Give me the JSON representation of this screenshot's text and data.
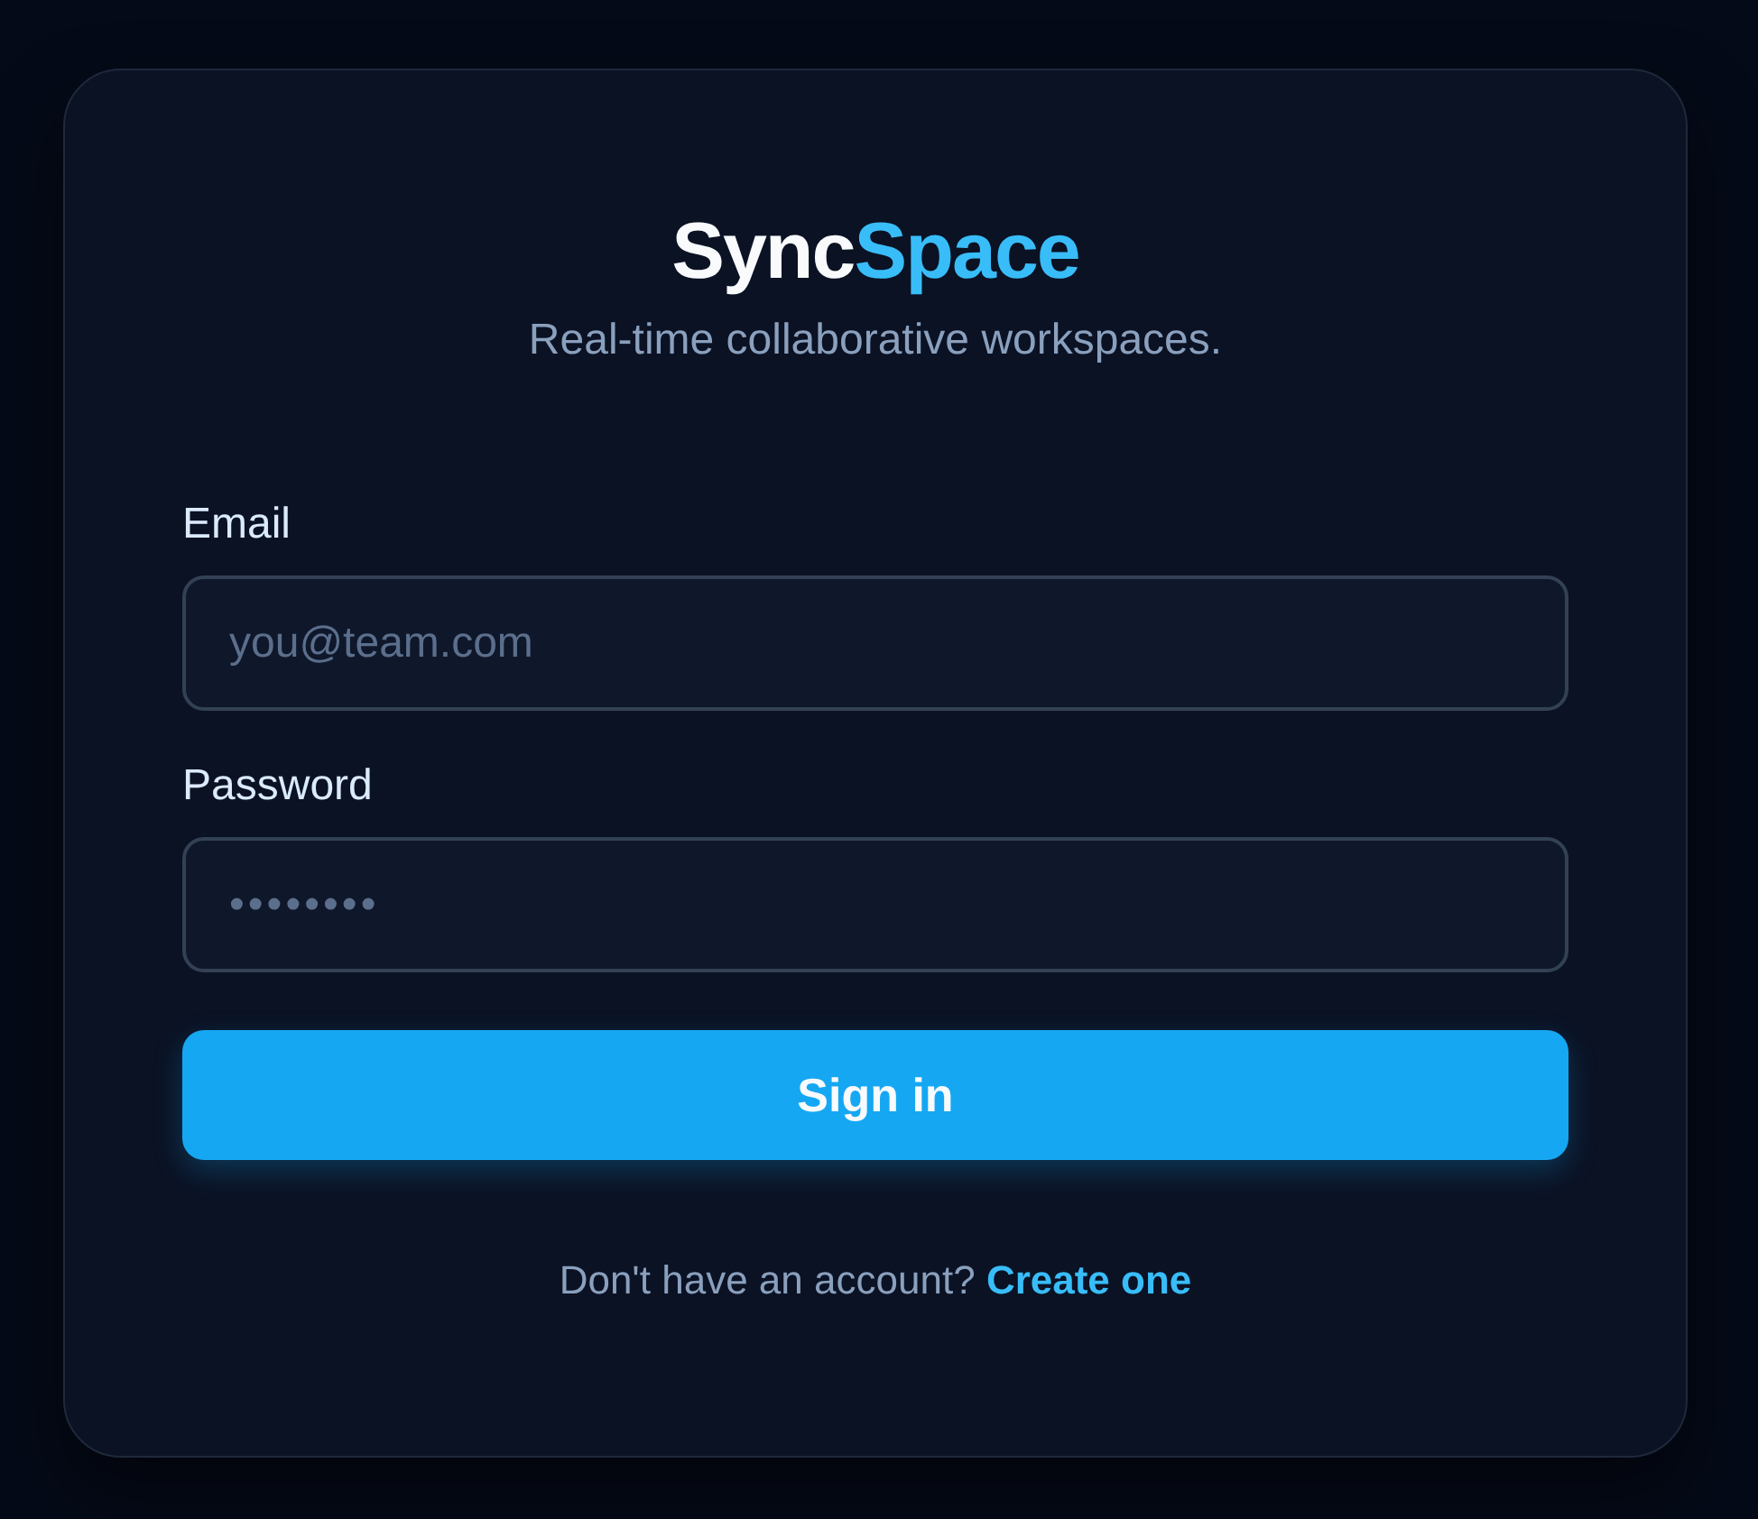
{
  "logo": {
    "part_1": "Sync",
    "part_2": "Space"
  },
  "tagline": "Real-time collaborative workspaces.",
  "fields": [
    {
      "label": "Email",
      "placeholder": "you@team.com",
      "kind": "email"
    },
    {
      "label": "Password",
      "placeholder": "••••••••",
      "kind": "password"
    }
  ],
  "submit": {
    "label": "Sign in"
  },
  "footer": {
    "text": "Don't have an account?",
    "link": "Create one"
  }
}
